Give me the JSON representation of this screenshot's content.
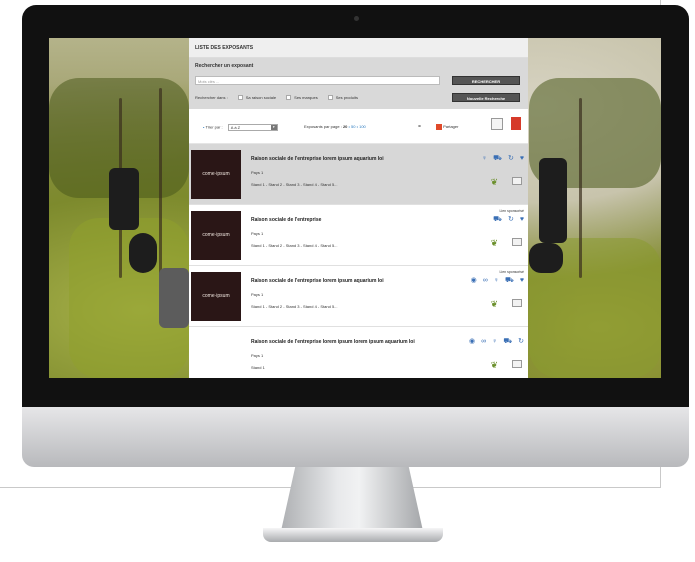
{
  "panel": {
    "title": "LISTE DES EXPOSANTS",
    "search": {
      "label": "Rechercher un exposant",
      "placeholder": "Mots clés ...",
      "search_button": "RECHERCHER",
      "new_search_button": "Nouvelle Recherche",
      "filter_label": "Rechercher dans :",
      "filters": [
        "Sa raison sociale",
        "Ses marques",
        "Ses produits"
      ]
    },
    "toolbar": {
      "sort_label": "Trier par :",
      "sort_value": "A à Z",
      "per_page_label": "Exposants par page :",
      "per_page_current": "20",
      "per_page_options": "• 50 • 100",
      "share_label": "Partager"
    },
    "rows": [
      {
        "logo": "come·ipsum",
        "title": "Raison sociale de l'entreprise lorem ipsum aquarium loi",
        "country": "Pays 1",
        "stands": "Stand 1 - Stand 2 - Stand 3 - Stand 4 - Stand 5...",
        "sponsor": ""
      },
      {
        "logo": "come·ipsum",
        "title": "Raison sociale de l'entreprise",
        "country": "Pays 1",
        "stands": "Stand 1 - Stand 2 - Stand 3 - Stand 4 - Stand 5...",
        "sponsor": "Lien sponsorisé"
      },
      {
        "logo": "come·ipsum",
        "title": "Raison sociale de l'entreprise lorem ipsum aquarium loi",
        "country": "Pays 1",
        "stands": "Stand 1 - Stand 2 - Stand 3 - Stand 4 - Stand 5...",
        "sponsor": "Lien sponsorisé"
      },
      {
        "logo": "",
        "title": "Raison sociale de l'entreprise lorem ipsum lorem ipsum aquarium loi",
        "country": "Pays 1",
        "stands": "Stand 1",
        "sponsor": ""
      }
    ]
  },
  "colors": {
    "accent": "#2a7ac0",
    "logo_bg": "#2a1616",
    "highlight_row": "#d7d7d7"
  }
}
